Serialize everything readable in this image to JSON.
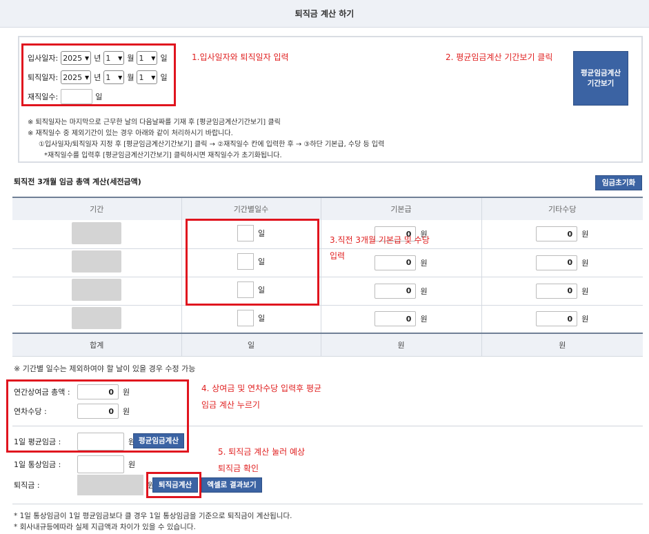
{
  "page_title": "퇴직금 계산 하기",
  "dates": {
    "hire_label": "입사일자:",
    "retire_label": "퇴직일자:",
    "year_value": "2025",
    "month_value": "1",
    "day_value": "1",
    "year_unit": "년",
    "month_unit": "월",
    "day_unit": "일",
    "work_days_label": "재직일수:",
    "work_days_unit": "일"
  },
  "period_button": {
    "line1": "평균임금계산",
    "line2": "기간보기"
  },
  "notes": [
    "※ 퇴직일자는 마지막으로 근무한 날의 다음날짜를 기재 후 [평균임금계산기간보기] 클릭",
    "※ 재직일수 중 제외기간이 있는 경우 아래와 같이 처리하시기 바랍니다.",
    "①입사일자/퇴직일자 지정 후 [평균임금계산기간보기] 클릭 → ②재직일수 칸에 입력한 후 → ③하단 기본급, 수당 등 입력",
    "*재직일수를 입력후 [평균임금계산기간보기] 클릭하시면 재직일수가 초기화됩니다."
  ],
  "annotations": {
    "a1": "1.입사일자와 퇴직일자 입력",
    "a2": "2. 평균임금계산 기간보기 클릭",
    "a3_line1": "3.직전 3개월 기본급 및 수당",
    "a3_line2": "입력",
    "a4_line1": "4. 상여금 및 연차수당 입력후 평균",
    "a4_line2": "임금 계산 누르기",
    "a5_line1": "5. 퇴직금 계산 눌러 예상",
    "a5_line2": "퇴직금 확인"
  },
  "section_title": "퇴직전 3개월 임금 총액 계산(세전금액)",
  "reset_button": "임금초기화",
  "table": {
    "headers": [
      "기간",
      "기간별일수",
      "기본급",
      "기타수당"
    ],
    "rows": [
      {
        "days_unit": "일",
        "base": "0",
        "base_unit": "원",
        "other": "0",
        "other_unit": "원"
      },
      {
        "days_unit": "일",
        "base": "0",
        "base_unit": "원",
        "other": "0",
        "other_unit": "원"
      },
      {
        "days_unit": "일",
        "base": "0",
        "base_unit": "원",
        "other": "0",
        "other_unit": "원"
      },
      {
        "days_unit": "일",
        "base": "0",
        "base_unit": "원",
        "other": "0",
        "other_unit": "원"
      }
    ],
    "total": {
      "label": "합계",
      "days": "일",
      "base": "원",
      "other": "원"
    }
  },
  "table_note": "※ 기간별 일수는 제외하여야 할 날이 있을 경우 수정 가능",
  "bonus": {
    "annual_bonus_label": "연간상여금 총액 :",
    "annual_bonus_value": "0",
    "leave_allowance_label": "연차수당 :",
    "leave_allowance_value": "0",
    "unit": "원"
  },
  "avg_wage": {
    "label": "1일 평균임금 :",
    "unit": "원",
    "button": "평균임금계산"
  },
  "ordinary_wage": {
    "label": "1일 통상임금 :",
    "unit": "원"
  },
  "severance": {
    "label": "퇴직금 :",
    "unit": "원",
    "calc_button": "퇴직금계산",
    "excel_button": "엑셀로 결과보기"
  },
  "footer_notes": [
    "* 1일 통상임금이 1일 평균임금보다 클 경우 1일 통상임금을 기준으로 퇴직금이 계산됩니다.",
    "* 회사내규등에따라 실제 지급액과 차이가 있을 수 있습니다."
  ]
}
